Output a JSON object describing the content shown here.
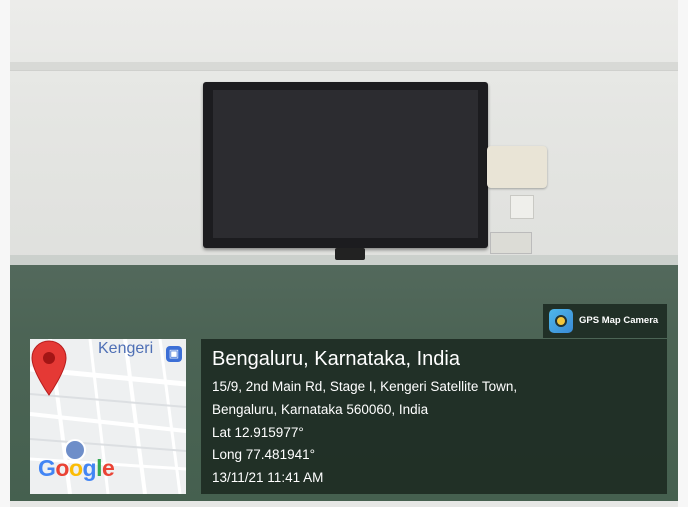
{
  "watermark": {
    "app_name": "GPS Map Camera",
    "app_icon": "camera-lens-icon"
  },
  "map": {
    "area_label": "Kengeri",
    "transit_icon": "bus-icon",
    "marker_icon": "location-pin-icon",
    "poi_icon": "poi-icon",
    "provider_logo": "Google"
  },
  "location": {
    "city": "Bengaluru, Karnataka, India",
    "address_line1": "15/9, 2nd Main Rd, Stage I, Kengeri Satellite Town,",
    "address_line2": "Bengaluru, Karnataka 560060, India",
    "latitude": "Lat 12.915977°",
    "longitude": "Long 77.481941°",
    "timestamp": "13/11/21 11:41 AM"
  },
  "colors": {
    "overlay_bg": "#1e2c24",
    "pin_red": "#e53935",
    "map_label_blue": "#4e6fb5"
  }
}
